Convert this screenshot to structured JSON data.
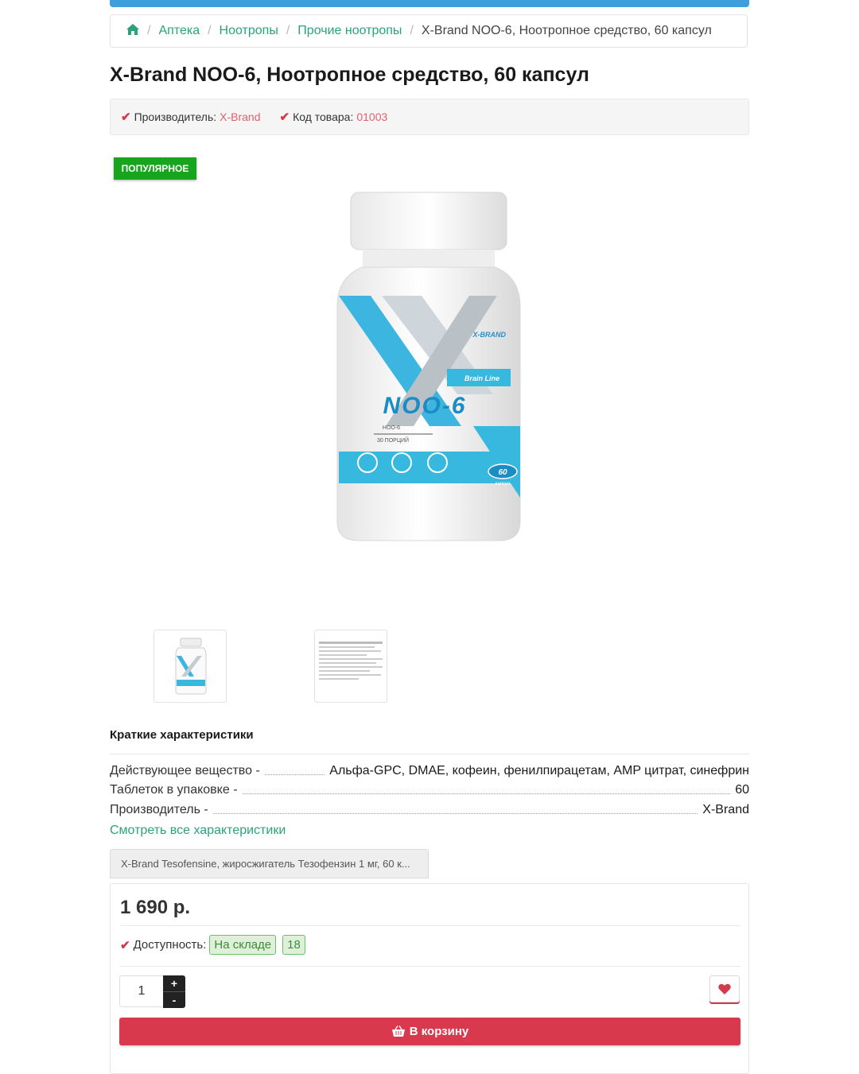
{
  "breadcrumb": {
    "home_icon": "home-icon",
    "items": [
      "Аптека",
      "Ноотропы",
      "Прочие ноотропы"
    ],
    "current": "X-Brand NOO-6, Ноотропное средство, 60 капсул",
    "separator": "/"
  },
  "product": {
    "title": "X-Brand NOO-6, Ноотропное средство, 60 капсул",
    "manufacturer_label": "Производитель:",
    "manufacturer": "X-Brand",
    "code_label": "Код товара:",
    "code": "01003",
    "badge": "ПОПУЛЯРНОЕ",
    "image": {
      "brand": "X-BRAND",
      "line": "Brain Line",
      "name": "NOO-6",
      "sub1": "НОО-6",
      "sub2": "30 ПОРЦИЙ",
      "count": "60",
      "count_unit": "капсул"
    }
  },
  "specs": {
    "title": "Краткие характеристики",
    "rows": [
      {
        "label": "Действующее вещество -",
        "value": "Альфа-GPC, DMAE, кофеин, фенилпирацетам, AMP цитрат, синефрин"
      },
      {
        "label": "Таблеток в упаковке -",
        "value": "60"
      },
      {
        "label": "Производитель -",
        "value": "X-Brand"
      }
    ],
    "see_all": "Смотреть все характеристики"
  },
  "related_tab": "X-Brand Tesofensine, жиросжигатель Тезофензин 1 мг, 60 к...",
  "buy": {
    "price": "1 690 р.",
    "availability_label": "Доступность:",
    "stock_status": "На складе",
    "stock_count": "18",
    "quantity": "1",
    "plus": "+",
    "minus": "-",
    "add_to_cart": "В корзину"
  },
  "colors": {
    "accent_green": "#2aa37c",
    "badge_green": "#16a51c",
    "cart_red": "#d9394c",
    "top_bar_blue": "#3d9fdc"
  }
}
